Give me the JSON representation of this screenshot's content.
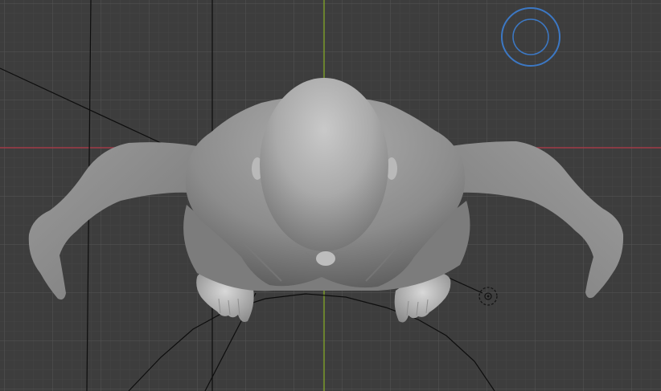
{
  "viewport": {
    "view": "top-orthographic",
    "background_color": "#3d3d3d",
    "grid_minor_color": "#454545",
    "grid_major_color": "#535353",
    "x_axis_color": "#a23b48",
    "y_axis_color": "#7a9a2a",
    "model_color": "#a9a9a9",
    "light_gizmo_color": "#3c78c4",
    "guide_line_color": "#0d0d0d"
  },
  "scene_objects": [
    {
      "name": "sculpt-figure",
      "type": "mesh"
    },
    {
      "name": "light-gizmo",
      "type": "light"
    },
    {
      "name": "object-origin",
      "type": "empty"
    }
  ]
}
